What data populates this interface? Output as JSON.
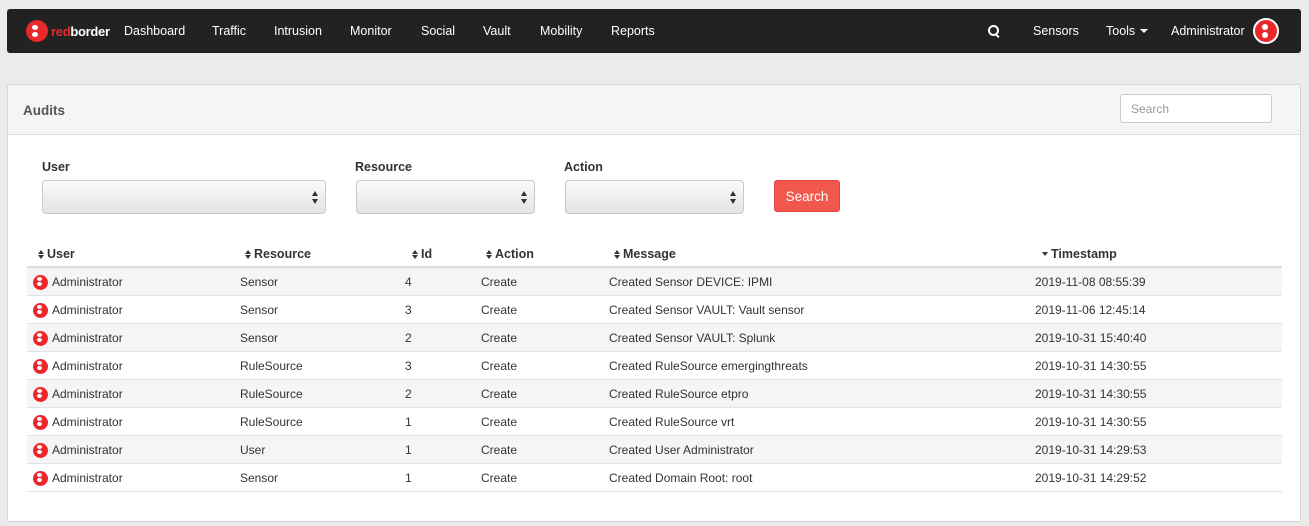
{
  "navbar": {
    "brand": {
      "part1": "red",
      "part2": "border"
    },
    "items": [
      "Dashboard",
      "Traffic",
      "Intrusion",
      "Monitor",
      "Social",
      "Vault",
      "Mobility",
      "Reports"
    ],
    "search_icon": "search-icon",
    "sensors_label": "Sensors",
    "tools_label": "Tools",
    "user_label": "Administrator"
  },
  "panel": {
    "title": "Audits",
    "search_placeholder": "Search"
  },
  "filters": {
    "user_label": "User",
    "resource_label": "Resource",
    "action_label": "Action",
    "user_value": "",
    "resource_value": "",
    "action_value": "",
    "search_button": "Search"
  },
  "table": {
    "columns": [
      "User",
      "Resource",
      "Id",
      "Action",
      "Message",
      "Timestamp"
    ],
    "sort": {
      "column": "Timestamp",
      "direction": "desc"
    },
    "rows": [
      {
        "user": "Administrator",
        "resource": "Sensor",
        "id": "4",
        "action": "Create",
        "message": "Created Sensor DEVICE: IPMI",
        "timestamp": "2019-11-08 08:55:39"
      },
      {
        "user": "Administrator",
        "resource": "Sensor",
        "id": "3",
        "action": "Create",
        "message": "Created Sensor VAULT: Vault sensor",
        "timestamp": "2019-11-06 12:45:14"
      },
      {
        "user": "Administrator",
        "resource": "Sensor",
        "id": "2",
        "action": "Create",
        "message": "Created Sensor VAULT: Splunk",
        "timestamp": "2019-10-31 15:40:40"
      },
      {
        "user": "Administrator",
        "resource": "RuleSource",
        "id": "3",
        "action": "Create",
        "message": "Created RuleSource emergingthreats",
        "timestamp": "2019-10-31 14:30:55"
      },
      {
        "user": "Administrator",
        "resource": "RuleSource",
        "id": "2",
        "action": "Create",
        "message": "Created RuleSource etpro",
        "timestamp": "2019-10-31 14:30:55"
      },
      {
        "user": "Administrator",
        "resource": "RuleSource",
        "id": "1",
        "action": "Create",
        "message": "Created RuleSource vrt",
        "timestamp": "2019-10-31 14:30:55"
      },
      {
        "user": "Administrator",
        "resource": "User",
        "id": "1",
        "action": "Create",
        "message": "Created User Administrator",
        "timestamp": "2019-10-31 14:29:53"
      },
      {
        "user": "Administrator",
        "resource": "Sensor",
        "id": "1",
        "action": "Create",
        "message": "Created Domain Root: root",
        "timestamp": "2019-10-31 14:29:52"
      }
    ]
  },
  "colors": {
    "navbar_bg": "#222222",
    "brand_red": "#e8282b",
    "search_button": "#f2574d"
  }
}
